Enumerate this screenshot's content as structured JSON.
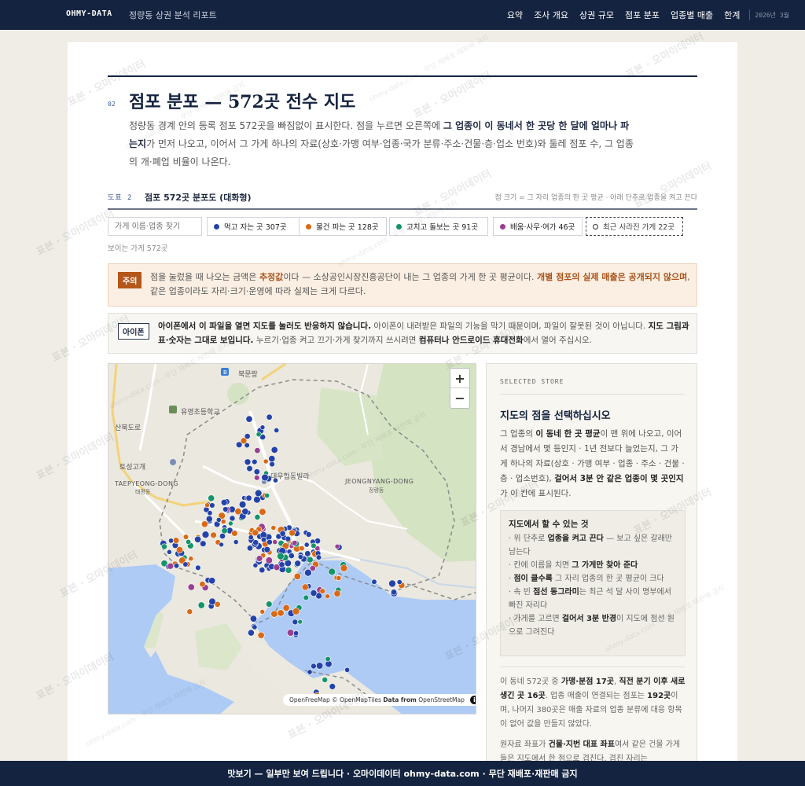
{
  "header": {
    "brand": "OHMY-DATA",
    "report_title": "정량동 상권 분석 리포트",
    "nav": [
      "요약",
      "조사 개요",
      "상권 규모",
      "점포 분포",
      "업종별 매출",
      "한계"
    ],
    "date": "2026년 3월"
  },
  "section": {
    "number": "02",
    "title": "점포 분포 — 572곳 전수 지도",
    "intro_a": "정량동 경계 안의 등록 점포 572곳을 빠짐없이 표시한다. 점을 누르면 오른쪽에 ",
    "intro_b": "그 업종이 이 동네서 한 곳당 한 달에 얼마나 파는지",
    "intro_c": "가 먼저 나오고, 이어서 그 가게 하나의 자료(상호·가맹 여부·업종·국가 분류·주소·건물·층·업소 번호)와 둘레 점포 수, 그 업종의 개·폐업 비율이 나온다."
  },
  "figure": {
    "label": "도표 2",
    "title": "점포 572곳 분포도 (대화형)",
    "note": "점 크기 = 그 자리 업종의 한 곳 평균 · 아래 단추로 업종을 켜고 끈다"
  },
  "filters": {
    "search_placeholder": "가게 이름·업종 찾기",
    "chips": [
      {
        "label": "먹고 자는 곳 307곳",
        "color": "#2443a8"
      },
      {
        "label": "물건 파는 곳 128곳",
        "color": "#d86a16"
      },
      {
        "label": "고치고 돌보는 곳 91곳",
        "color": "#15936b"
      },
      {
        "label": "배움·사무·여가 46곳",
        "color": "#9a3f92"
      }
    ],
    "closed_chip": "최근 사라진 가게 22곳",
    "visible_count": "보이는 가게 572곳"
  },
  "notice": {
    "badge": "주의",
    "t1": "점을 눌렀을 때 나오는 금액은 ",
    "t2": "추정값",
    "t3": "이다 — 소상공인시장진흥공단이 내는 그 업종의 가게 한 곳 평균이다. ",
    "t4": "개별 점포의 실제 매출은 공개되지 않으며",
    "t5": ", 같은 업종이라도 자리·크기·운영에 따라 실제는 크게 다르다."
  },
  "ios_notice": {
    "badge": "아이폰",
    "t1": "아이폰에서 이 파일을 열면 지도를 눌러도 반응하지 않습니다.",
    "t2": " 아이폰이 내려받은 파일의 기능을 막기 때문이며, 파일이 잘못된 것이 아닙니다. ",
    "t3": "지도 그림과 표·숫자는 그대로 보입니다.",
    "t4": " 누르기·업종 켜고 끄기·가게 찾기까지 쓰시려면 ",
    "t5": "컴퓨터나 안드로이드 휴대전화",
    "t6": "에서 열어 주십시오."
  },
  "map": {
    "labels": {
      "bukmun": "북문랑",
      "school": "유영초등학교",
      "sanbuk": "산북도로",
      "toseong": "토성고개",
      "taepyeong_en": "TAEPYEONG-DONG",
      "taepyeong_ko": "태평동",
      "daewoo": "대우협동빌라",
      "jeong_en": "JEONGNYANG-DONG",
      "jeong_ko": "정량동"
    },
    "zoom_in": "+",
    "zoom_out": "−",
    "attribution_a": "OpenFreeMap © OpenMapTiles ",
    "attribution_b": "Data from",
    "attribution_c": " OpenStreetMap",
    "info": "i"
  },
  "side": {
    "kicker": "SELECTED STORE",
    "title": "지도의 점을 선택하십시오",
    "p1_a": "그 업종의 ",
    "p1_b": "이 동네 한 곳 평균",
    "p1_c": "이 맨 위에 나오고, 이어서 경남에서 몇 등인지 · 1년 전보다 늘었는지, 그 가게 하나의 자료(상호 · 가맹 여부 · 업종 · 주소 · 건물 · 층 · 업소번호), ",
    "p1_d": "걸어서 3분 안 같은 업종이 몇 곳인지",
    "p1_e": "가 이 칸에 표시된다.",
    "tips_title": "지도에서 할 수 있는 것",
    "tips": [
      {
        "a": "· 위 단추로 ",
        "b": "업종을 켜고 끈다",
        "c": " — 보고 싶은 갈래만 남는다"
      },
      {
        "a": "· 칸에 이름을 치면 ",
        "b": "그 가게만 찾아 준다",
        "c": ""
      },
      {
        "a": "· ",
        "b": "점이 클수록",
        "c": " 그 자리 업종의 한 곳 평균이 크다"
      },
      {
        "a": "· 속 빈 ",
        "b": "점선 동그라미",
        "c": "는 최근 석 달 사이 명부에서 빠진 자리다"
      },
      {
        "a": "· 가게를 고르면 ",
        "b": "걸어서 3분 반경",
        "c": "이 지도에 점선 원으로 그려진다"
      }
    ],
    "p2_a": "이 동네 572곳 중 ",
    "p2_b": "가맹·분점 17곳",
    "p2_c": ", ",
    "p2_d": "직전 분기 이후 새로 생긴 곳 16곳",
    "p2_e": ". 업종 매출이 연결되는 점포는 ",
    "p2_f": "192곳",
    "p2_g": "이며, 나머지 380곳은 매출 자료의 업종 분류에 대응 항목이 없어 값을 만들지 않았다.",
    "p3_a": "원자료 좌표가 ",
    "p3_b": "건물·지번 대표 좌표",
    "p3_c": "여서 같은 건물 가게들은 지도에서 한 점으로 겹친다. 겹친 자리는"
  },
  "footer": "맛보기 — 일부만 보여 드립니다 · 오마이데이터 ohmy-data.com · 무단 재배포·재판매 금지",
  "watermark": {
    "main": "표본 · 오마이데이터",
    "sub": "ohmy-data.com · 무단 재배포·재판매 금지"
  }
}
